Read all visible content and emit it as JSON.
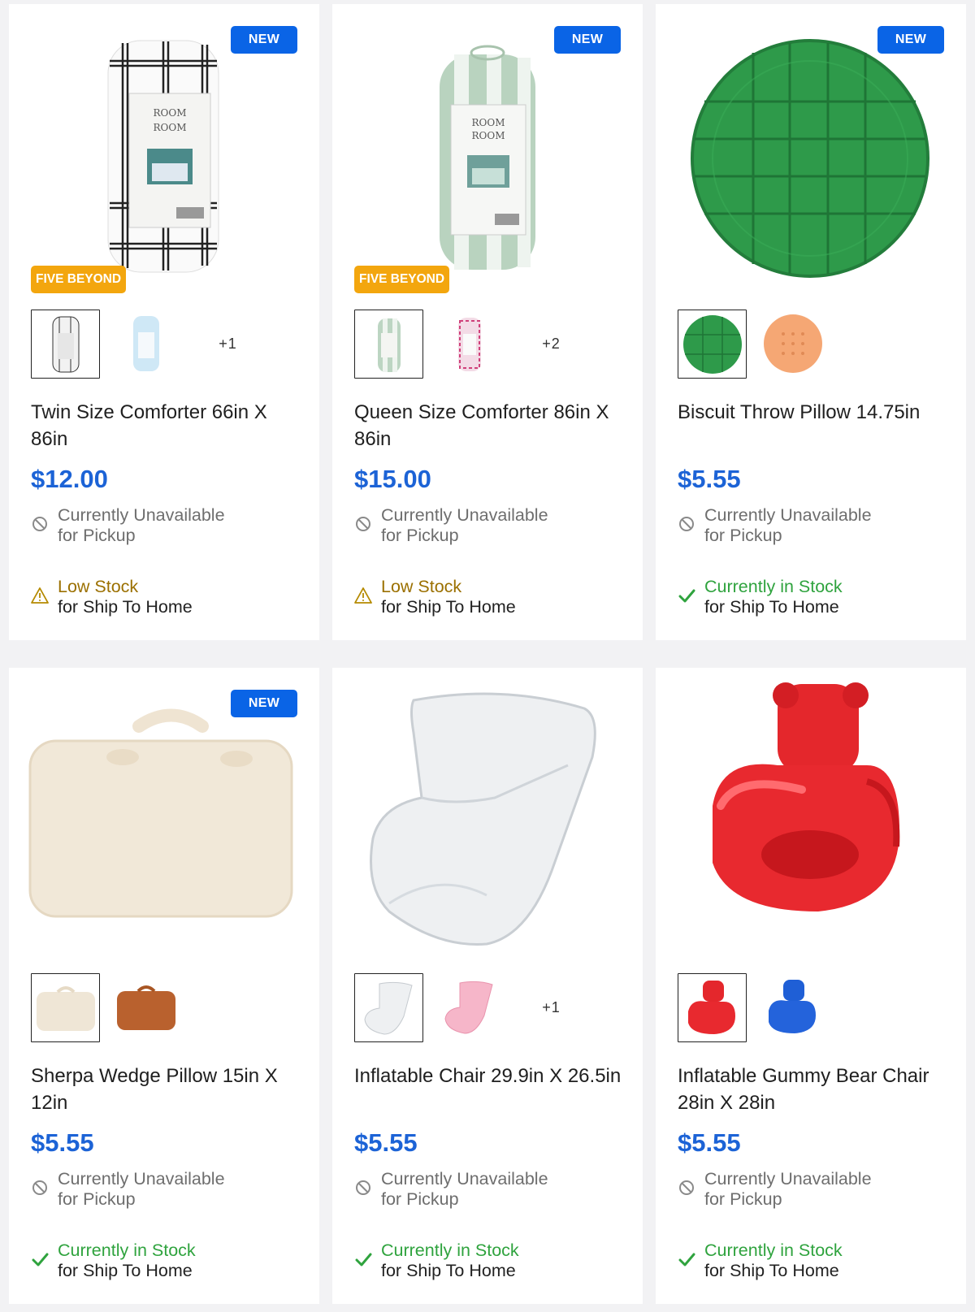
{
  "badges": {
    "new": "NEW",
    "five_beyond": "FIVE BEYOND"
  },
  "status_text": {
    "unavailable": "Currently Unavailable",
    "for_pickup": "for Pickup",
    "low_stock": "Low Stock",
    "in_stock": "Currently in Stock",
    "for_ship": "for Ship To Home"
  },
  "colors": {
    "price": "#1c63d6",
    "new_badge": "#0a64e6",
    "five_badge": "#f3a60e",
    "in_stock": "#2fa33e",
    "low_stock": "#9b7000"
  },
  "products": [
    {
      "title": "Twin Size Comforter 66in X 86in",
      "price": "$12.00",
      "more_swatches": "+1",
      "ship_status": "Low Stock",
      "badge_new": true,
      "badge_five": true
    },
    {
      "title": "Queen Size Comforter 86in X 86in",
      "price": "$15.00",
      "more_swatches": "+2",
      "ship_status": "Low Stock",
      "badge_new": true,
      "badge_five": true
    },
    {
      "title": "Biscuit Throw Pillow 14.75in",
      "price": "$5.55",
      "more_swatches": "",
      "ship_status": "Currently in Stock",
      "badge_new": true,
      "badge_five": false
    },
    {
      "title": "Sherpa Wedge Pillow 15in X 12in",
      "price": "$5.55",
      "more_swatches": "",
      "ship_status": "Currently in Stock",
      "badge_new": true,
      "badge_five": false
    },
    {
      "title": "Inflatable Chair 29.9in X 26.5in",
      "price": "$5.55",
      "more_swatches": "+1",
      "ship_status": "Currently in Stock",
      "badge_new": false,
      "badge_five": false
    },
    {
      "title": "Inflatable Gummy Bear Chair 28in X 28in",
      "price": "$5.55",
      "more_swatches": "",
      "ship_status": "Currently in Stock",
      "badge_new": false,
      "badge_five": false
    }
  ]
}
